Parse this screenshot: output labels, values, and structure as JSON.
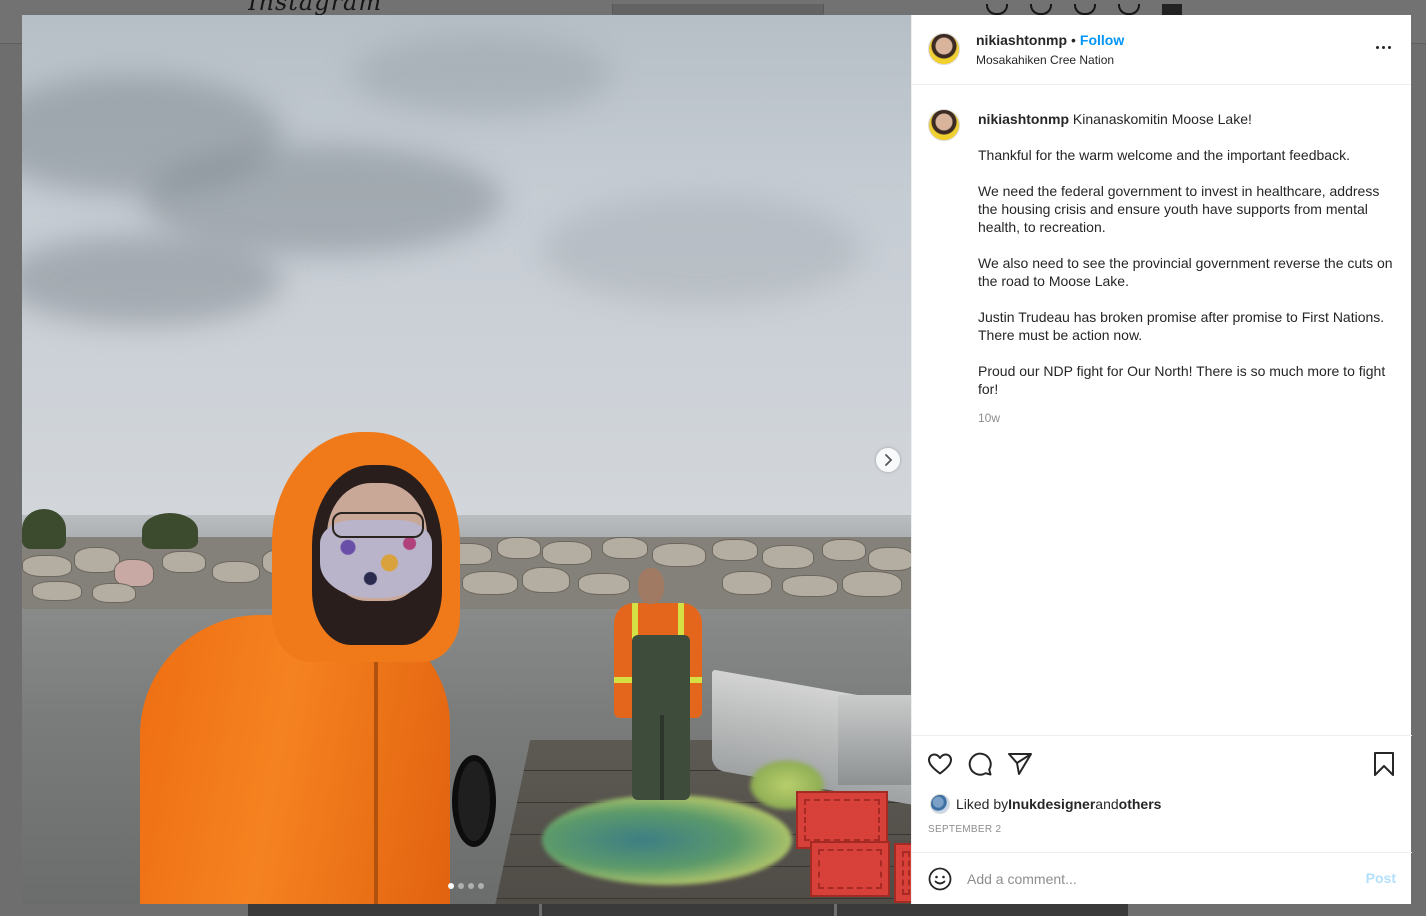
{
  "background": {
    "logo_text": "Instagram"
  },
  "post": {
    "username": "nikiashtonmp",
    "separator": "•",
    "follow_label": "Follow",
    "location": "Mosakahiken Cree Nation",
    "caption": {
      "username": "nikiashtonmp",
      "first_line": " Kinanaskomitin Moose Lake!",
      "paragraphs": [
        "Thankful for the warm welcome and the important feedback.",
        "We need the federal government to invest in healthcare, address the housing crisis and ensure youth have supports from mental health, to recreation.",
        "We also need to see the provincial government reverse the cuts on the road to Moose Lake.",
        "Justin Trudeau has broken promise after promise to First Nations. There must be action now.",
        "Proud our NDP fight for Our North! There is so much more to fight for!"
      ]
    },
    "time_ago": "10w",
    "likes": {
      "prefix": "Liked by ",
      "user": "Inukdesigner",
      "middle": " and ",
      "others": "others"
    },
    "date": "SEPTEMBER 2",
    "comment_placeholder": "Add a comment...",
    "post_label": "Post",
    "carousel": {
      "total": 4,
      "active_index": 0
    }
  },
  "icons": {
    "more": "more-options-icon",
    "like": "heart-icon",
    "comment": "comment-bubble-icon",
    "share": "paper-plane-icon",
    "save": "bookmark-icon",
    "emoji": "emoji-icon",
    "next": "chevron-right-icon"
  },
  "colors": {
    "accent": "#0095f6",
    "post_disabled": "#b2dffc",
    "muted": "#8e8e8e",
    "hoodie": "#f58220"
  }
}
